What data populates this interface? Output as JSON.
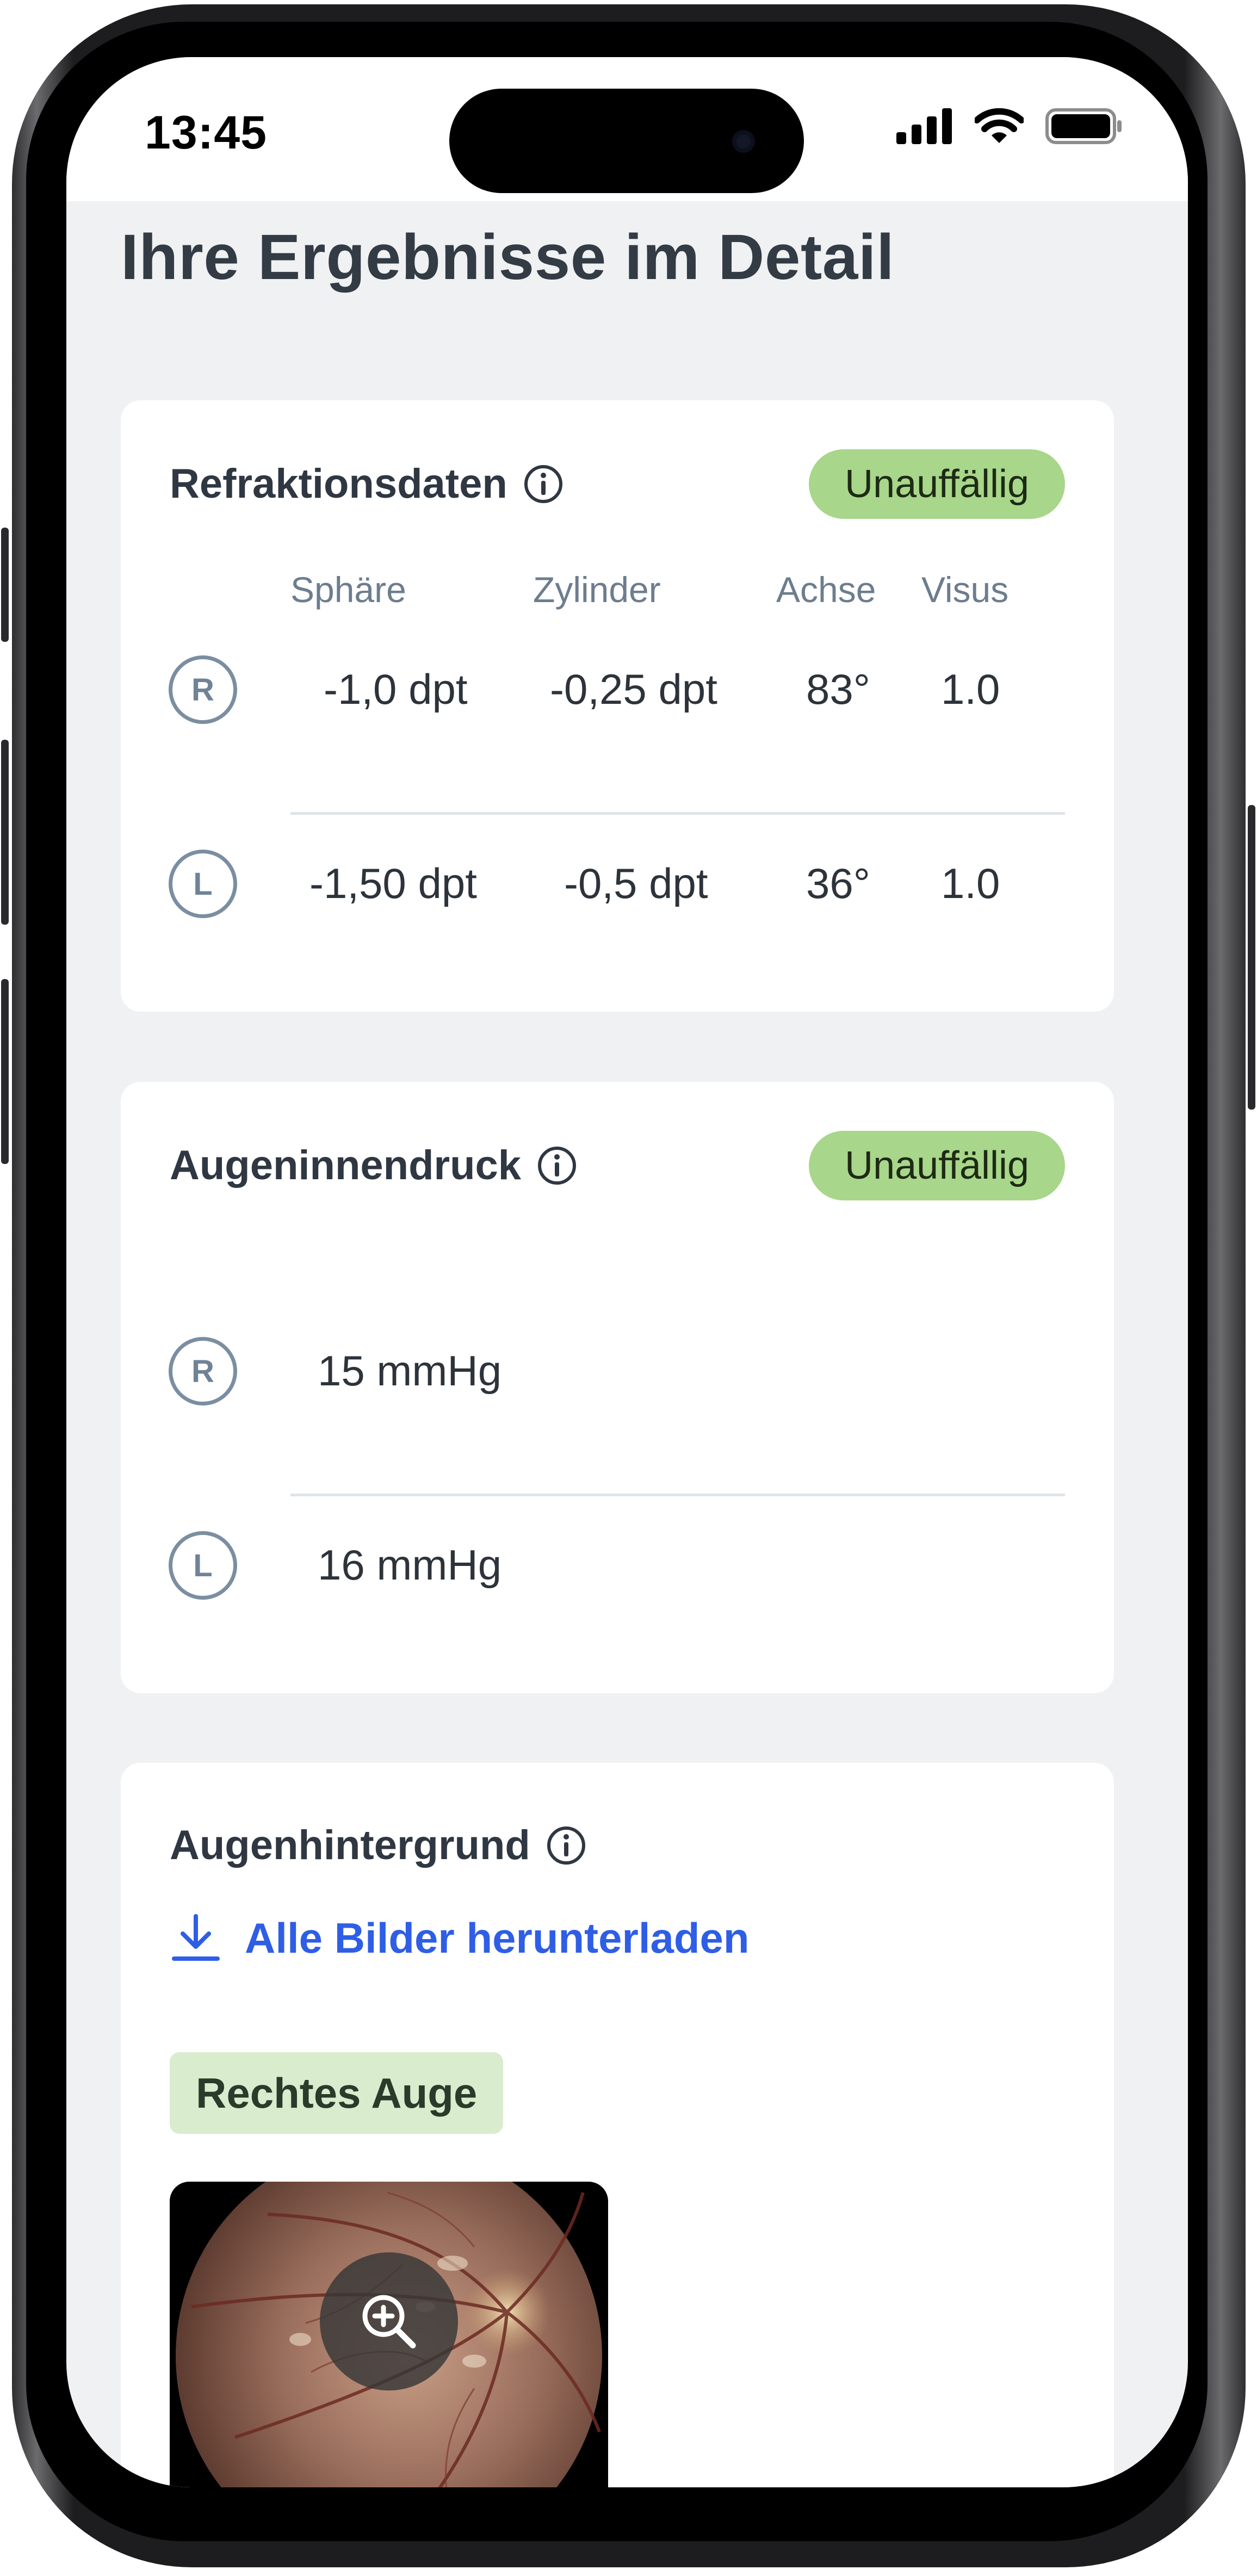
{
  "status_bar": {
    "time": "13:45"
  },
  "page": {
    "title": "Ihre Ergebnisse im Detail"
  },
  "refraction": {
    "title": "Refraktionsdaten",
    "badge": "Unauffällig",
    "columns": [
      "Sphäre",
      "Zylinder",
      "Achse",
      "Visus"
    ],
    "rows": [
      {
        "eye": "R",
        "values": [
          "-1,0 dpt",
          "-0,25 dpt",
          "83°",
          "1.0"
        ]
      },
      {
        "eye": "L",
        "values": [
          "-1,50 dpt",
          "-0,5 dpt",
          "36°",
          "1.0"
        ]
      }
    ]
  },
  "pressure": {
    "title": "Augeninnendruck",
    "badge": "Unauffällig",
    "rows": [
      {
        "eye": "R",
        "value": "15 mmHg"
      },
      {
        "eye": "L",
        "value": "16 mmHg"
      }
    ]
  },
  "fundus": {
    "title": "Augenhintergrund",
    "download_label": "Alle Bilder herunterladen",
    "tag": "Rechtes Auge"
  },
  "colors": {
    "badge": "#a8d68a",
    "link": "#2f5ee6",
    "tag": "#d9eccd",
    "background": "#f0f1f3"
  }
}
